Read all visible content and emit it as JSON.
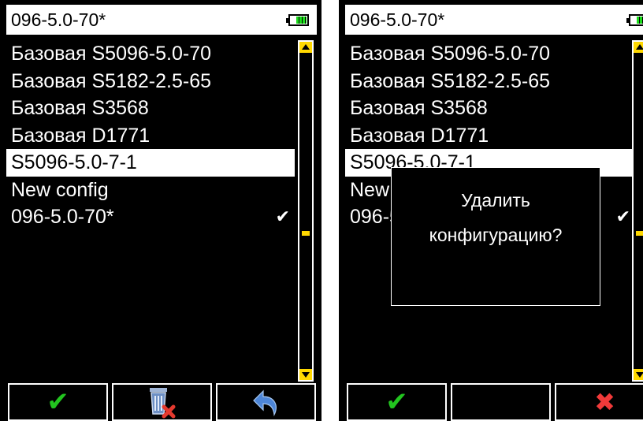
{
  "colors": {
    "accent_green": "#22c41f",
    "scroll_yellow": "#ffd800",
    "delete_red": "#f13a3a"
  },
  "left": {
    "header": {
      "title": "096-5.0-70*"
    },
    "list": [
      {
        "label": "Базовая S5096-5.0-70"
      },
      {
        "label": "Базовая S5182-2.5-65"
      },
      {
        "label": "Базовая S3568"
      },
      {
        "label": "Базовая D1771"
      },
      {
        "label": "S5096-5.0-7-1",
        "selected": true
      },
      {
        "label": "New config"
      },
      {
        "label": "096-5.0-70*",
        "check": "✔"
      }
    ],
    "softkeys": {
      "k1_icon": "check-icon",
      "k2_icon": "trash-delete-icon",
      "k3_icon": "undo-arrow-icon"
    }
  },
  "right": {
    "header": {
      "title": "096-5.0-70*"
    },
    "list": [
      {
        "label": "Базовая S5096-5.0-70"
      },
      {
        "label": "Базовая S5182-2.5-65"
      },
      {
        "label": "Базовая S3568"
      },
      {
        "label": "Базовая D1771"
      },
      {
        "label": "S5096-5.0-7-1",
        "selected": true
      },
      {
        "label": "New config"
      },
      {
        "label": "096-5.0-70*",
        "check": "✔"
      }
    ],
    "dialog": {
      "line1": "Удалить",
      "line2": "конфигурацию?"
    },
    "softkeys": {
      "k1_icon": "check-icon",
      "k2_icon": "",
      "k3_icon": "cross-icon"
    }
  }
}
